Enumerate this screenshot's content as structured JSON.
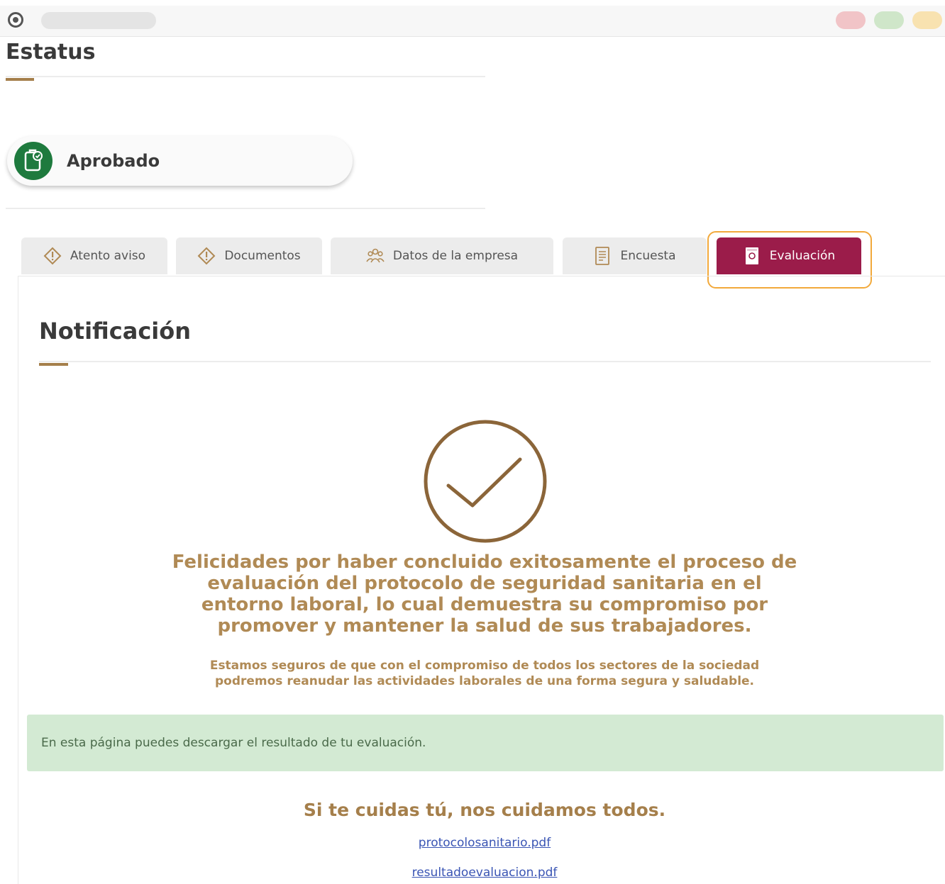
{
  "browser": {
    "logo_icon": "circle-logo-icon",
    "dots": [
      {
        "name": "close",
        "color": "#f1c4c7"
      },
      {
        "name": "maximize",
        "color": "#cfe6c9"
      },
      {
        "name": "minimize",
        "color": "#f8e2b0"
      }
    ]
  },
  "status": {
    "title": "Estatus",
    "label": "Aprobado",
    "icon": "clipboard-check-icon",
    "icon_color": "#1e7a3e"
  },
  "tabs": [
    {
      "label": "Atento aviso",
      "icon": "diamond-alert-icon",
      "active": false
    },
    {
      "label": "Documentos",
      "icon": "diamond-alert-icon",
      "active": false
    },
    {
      "label": "Datos de la empresa",
      "icon": "people-icon",
      "active": false
    },
    {
      "label": "Encuesta",
      "icon": "document-list-icon",
      "active": false
    },
    {
      "label": "Evaluación",
      "icon": "document-icon",
      "active": true
    }
  ],
  "notification": {
    "title": "Notificación",
    "check_icon": "circle-check-icon",
    "message": "Felicidades por haber concluido exitosamente el proceso de evaluación del protocolo de seguridad sanitaria en el entorno laboral, lo cual demuestra su compromiso por promover y mantener la salud de sus trabajadores.",
    "submessage": "Estamos seguros de que con el compromiso de todos los sectores de la sociedad podremos reanudar las actividades laborales de una forma segura y saludable.",
    "alert": "En esta página puedes descargar el resultado de tu evaluación.",
    "slogan": "Si te cuidas tú, nos cuidamos todos.",
    "links": [
      "protocolosanitario.pdf",
      "resultadoevaluacion.pdf"
    ]
  },
  "colors": {
    "accent_gold": "#a57f4b",
    "active_tab": "#9b1c4a",
    "highlight": "#f2a93b",
    "alert_bg": "#d3ead3",
    "link": "#3a55b4"
  }
}
